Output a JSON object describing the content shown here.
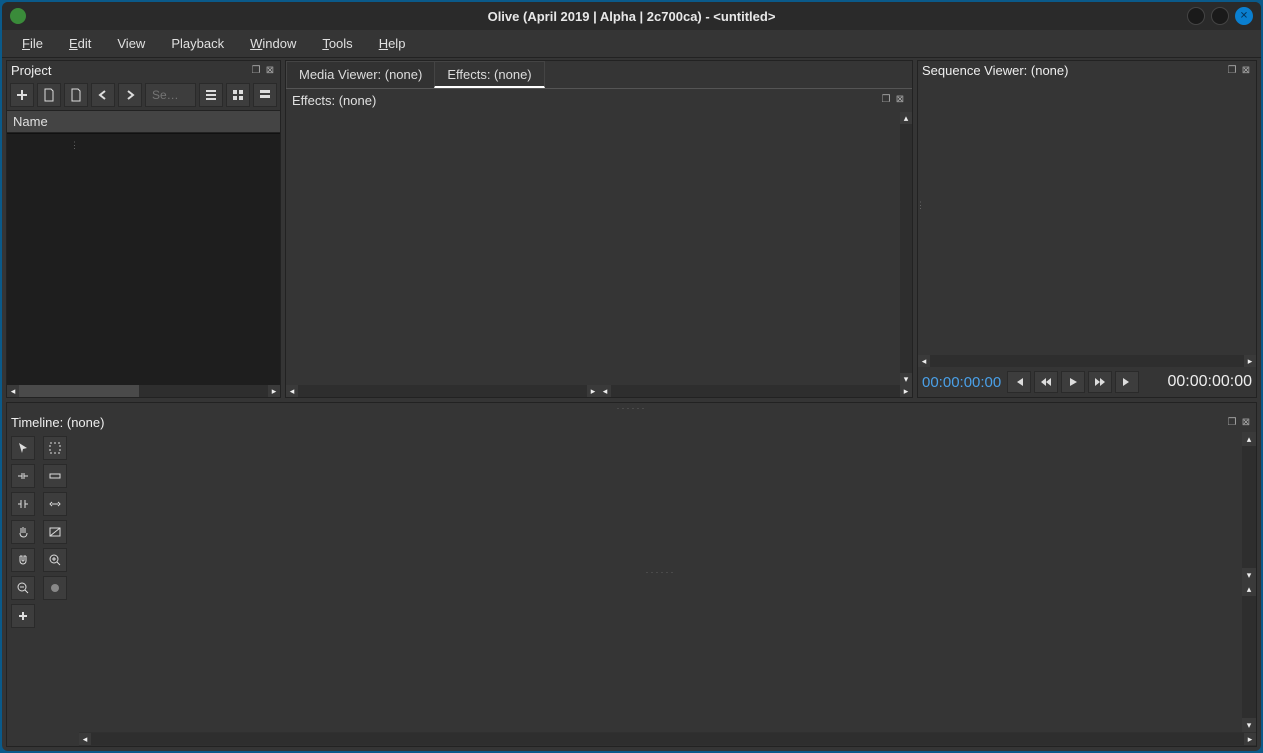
{
  "window": {
    "title": "Olive (April 2019 | Alpha | 2c700ca) - <untitled>"
  },
  "menu": {
    "file": "File",
    "edit": "Edit",
    "view": "View",
    "playback": "Playback",
    "window": "Window",
    "tools": "Tools",
    "help": "Help"
  },
  "project": {
    "title": "Project",
    "search_placeholder": "Se…",
    "column_name": "Name"
  },
  "tabs": {
    "media_viewer": "Media Viewer: (none)",
    "effects": "Effects: (none)"
  },
  "effects": {
    "subtitle": "Effects: (none)"
  },
  "sequence_viewer": {
    "title": "Sequence Viewer: (none)",
    "tc_left": "00:00:00:00",
    "tc_right": "00:00:00:00"
  },
  "timeline": {
    "title": "Timeline: (none)"
  }
}
